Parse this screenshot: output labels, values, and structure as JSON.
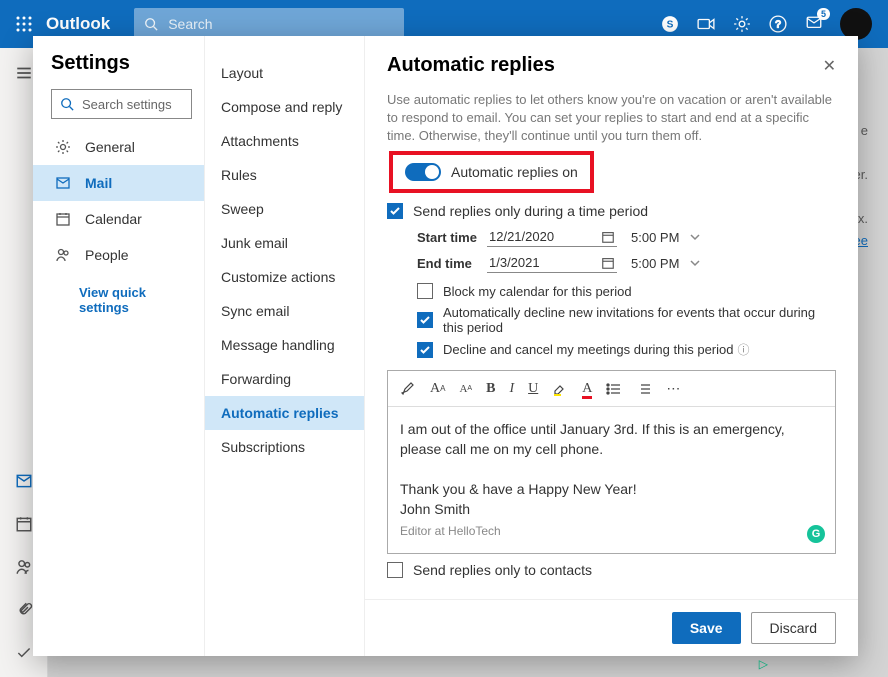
{
  "header": {
    "brand": "Outlook",
    "search_placeholder": "Search",
    "notification_count": "5"
  },
  "sidebar_cats": {
    "general": "General",
    "mail": "Mail",
    "calendar": "Calendar",
    "people": "People",
    "quick": "View quick settings"
  },
  "settings_title": "Settings",
  "search_settings_placeholder": "Search settings",
  "subnav": {
    "layout": "Layout",
    "compose": "Compose and reply",
    "attachments": "Attachments",
    "rules": "Rules",
    "sweep": "Sweep",
    "junk": "Junk email",
    "customize": "Customize actions",
    "sync": "Sync email",
    "handling": "Message handling",
    "forwarding": "Forwarding",
    "autoreply": "Automatic replies",
    "subs": "Subscriptions"
  },
  "pane": {
    "title": "Automatic replies",
    "description": "Use automatic replies to let others know you're on vacation or aren't available to respond to email. You can set your replies to start and end at a specific time. Otherwise, they'll continue until you turn them off.",
    "toggle_label": "Automatic replies on",
    "timeperiod_label": "Send replies only during a time period",
    "start_label": "Start time",
    "end_label": "End time",
    "start_date": "12/21/2020",
    "end_date": "1/3/2021",
    "start_time": "5:00 PM",
    "end_time": "5:00 PM",
    "block_cal": "Block my calendar for this period",
    "decline_new": "Automatically decline new invitations for events that occur during this period",
    "decline_cancel": "Decline and cancel my meetings during this period",
    "editor_line1": "I am out of the office until January 3rd. If this is an emergency, please call me on my cell phone.",
    "editor_line2": "Thank you & have a Happy New Year!",
    "editor_line3": "John Smith",
    "editor_sig": "Editor at HelloTech",
    "contacts_only": "Send replies only to contacts",
    "save": "Save",
    "discard": "Discard"
  },
  "bg": {
    "l1": "e",
    "l2": "ter.",
    "l3": "ox.",
    "l4": "ee"
  }
}
